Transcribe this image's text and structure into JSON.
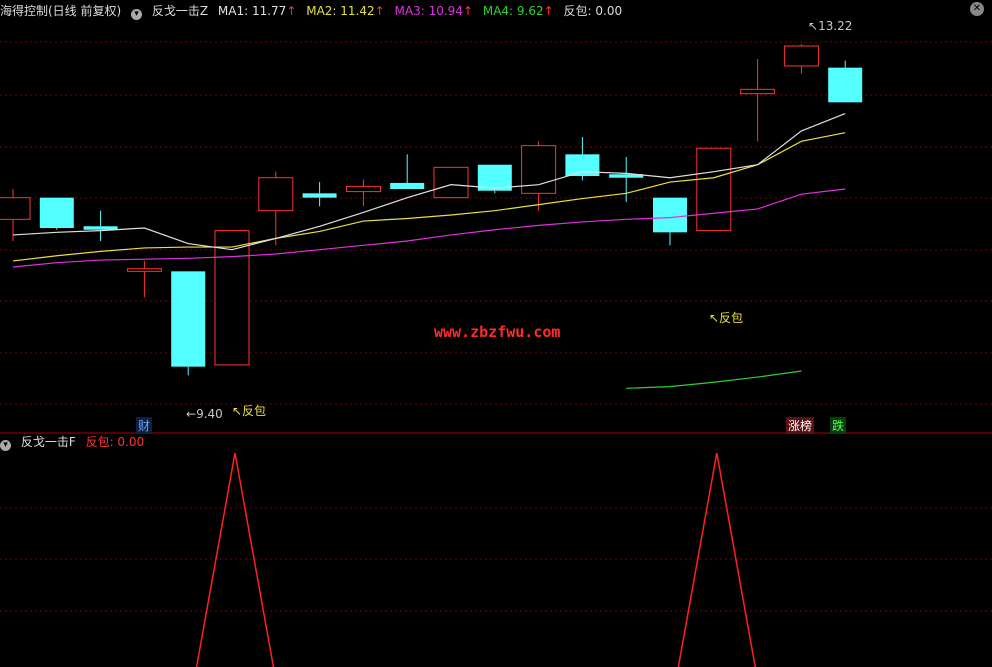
{
  "header": {
    "title": "海得控制(日线 前复权)",
    "indicator": "反戈一击Z",
    "ma1_label": "MA1: 11.77",
    "ma2_label": "MA2: 11.42",
    "ma3_label": "MA3: 10.94",
    "ma4_label": "MA4: 9.62",
    "fanbao_label": "反包: 0.00",
    "arrow": "↑",
    "close_icon": "close-icon",
    "collapse_icon": "chevron-down-icon"
  },
  "subheader": {
    "indicator": "反戈一击F",
    "fanbao_label": "反包: 0.00"
  },
  "annotations": {
    "high": "13.22",
    "low": "9.40",
    "fanbao1": "↖反包",
    "fanbao2": "↖反包",
    "cai": "财",
    "zhangbang": "涨榜",
    "die": "跌"
  },
  "watermark": "www.zbzfwu.com",
  "colors": {
    "up": "#ff3232",
    "down": "#54ffff",
    "ma1": "#e0e0e0",
    "ma2": "#e8e040",
    "ma3": "#e030e0",
    "ma4": "#30d030",
    "grid": "#7a0000",
    "signal": "#ff2020"
  },
  "chart_data": {
    "type": "candlestick",
    "price_range": [
      9.0,
      13.5
    ],
    "candles": [
      {
        "o": 11.2,
        "h": 11.55,
        "l": 10.95,
        "c": 11.45,
        "up": true
      },
      {
        "o": 11.45,
        "h": 11.45,
        "l": 11.08,
        "c": 11.1,
        "up": false
      },
      {
        "o": 11.12,
        "h": 11.3,
        "l": 10.95,
        "c": 11.08,
        "up": false
      },
      {
        "o": 10.6,
        "h": 10.72,
        "l": 10.3,
        "c": 10.63,
        "up": true
      },
      {
        "o": 10.6,
        "h": 10.6,
        "l": 9.4,
        "c": 9.5,
        "up": false
      },
      {
        "o": 9.52,
        "h": 11.07,
        "l": 9.52,
        "c": 11.07,
        "up": true
      },
      {
        "o": 11.3,
        "h": 11.75,
        "l": 10.9,
        "c": 11.68,
        "up": true
      },
      {
        "o": 11.5,
        "h": 11.63,
        "l": 11.35,
        "c": 11.45,
        "up": false
      },
      {
        "o": 11.52,
        "h": 11.66,
        "l": 11.35,
        "c": 11.58,
        "up": true
      },
      {
        "o": 11.62,
        "h": 11.95,
        "l": 11.55,
        "c": 11.55,
        "up": false
      },
      {
        "o": 11.45,
        "h": 11.8,
        "l": 11.45,
        "c": 11.8,
        "up": true
      },
      {
        "o": 11.83,
        "h": 11.83,
        "l": 11.5,
        "c": 11.53,
        "up": false
      },
      {
        "o": 11.5,
        "h": 12.1,
        "l": 11.3,
        "c": 12.05,
        "up": true
      },
      {
        "o": 11.95,
        "h": 12.15,
        "l": 11.65,
        "c": 11.7,
        "up": false
      },
      {
        "o": 11.72,
        "h": 11.92,
        "l": 11.4,
        "c": 11.68,
        "up": false
      },
      {
        "o": 11.45,
        "h": 11.45,
        "l": 10.9,
        "c": 11.05,
        "up": false
      },
      {
        "o": 11.07,
        "h": 12.02,
        "l": 11.07,
        "c": 12.02,
        "up": true
      },
      {
        "o": 12.65,
        "h": 13.05,
        "l": 12.1,
        "c": 12.7,
        "up": true
      },
      {
        "o": 12.97,
        "h": 13.22,
        "l": 12.88,
        "c": 13.2,
        "up": true
      },
      {
        "o": 12.95,
        "h": 13.03,
        "l": 12.55,
        "c": 12.55,
        "up": false
      }
    ],
    "ma1": [
      11.02,
      11.05,
      11.07,
      11.1,
      10.92,
      10.85,
      10.98,
      11.12,
      11.28,
      11.45,
      11.6,
      11.56,
      11.6,
      11.75,
      11.73,
      11.68,
      11.75,
      11.83,
      12.22,
      12.42
    ],
    "ma2": [
      10.72,
      10.78,
      10.83,
      10.87,
      10.88,
      10.88,
      10.98,
      11.06,
      11.18,
      11.21,
      11.25,
      11.3,
      11.37,
      11.44,
      11.5,
      11.63,
      11.68,
      11.83,
      12.1,
      12.2
    ],
    "ma3": [
      10.65,
      10.7,
      10.73,
      10.74,
      10.75,
      10.77,
      10.8,
      10.85,
      10.9,
      10.95,
      11.02,
      11.08,
      11.13,
      11.17,
      11.2,
      11.22,
      11.27,
      11.32,
      11.49,
      11.55
    ],
    "ma4": [
      9.25,
      9.27,
      9.32,
      9.38,
      9.45
    ],
    "signal": [
      0,
      0,
      0,
      0,
      0,
      1,
      0,
      0,
      0,
      0,
      0,
      0,
      0,
      0,
      0,
      0,
      1,
      0,
      0,
      0
    ]
  }
}
